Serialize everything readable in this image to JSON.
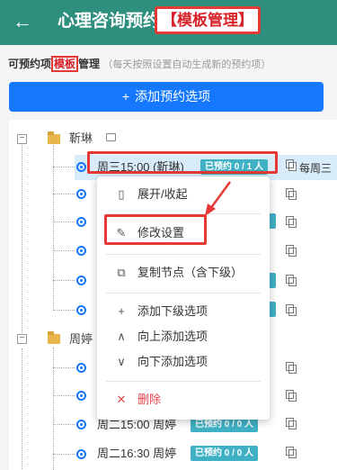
{
  "header": {
    "back_glyph": "←",
    "title": "心理咨询预约",
    "badge": "【模板管理】"
  },
  "subtitle": {
    "prefix": "可预约项",
    "highlight": "模板",
    "suffix": "管理",
    "note": "（每天按照设置自动生成新的预约项）"
  },
  "add_button": {
    "icon": "+",
    "label": "添加预约选项"
  },
  "tree": {
    "groups": [
      {
        "label": "靳琳",
        "expander": "−"
      },
      {
        "label": "周婷",
        "expander": "−"
      }
    ],
    "selected_item": {
      "label": "周三15:00 (靳琳)",
      "badge": "已预约 0 / 1 人",
      "extra": "每周三"
    },
    "bottom_items": [
      {
        "label": "周二15:00 周婷",
        "badge": "已预约 0 / 0 人"
      },
      {
        "label": "周二16:30 周婷",
        "badge": "已预约 0 / 0 人"
      }
    ]
  },
  "context_menu": {
    "items": [
      {
        "label": "展开/收起",
        "icon": "book-icon",
        "glyph": "▯"
      },
      {
        "label": "修改设置",
        "icon": "pencil-icon",
        "glyph": "✎"
      },
      {
        "label": "复制节点（含下级）",
        "icon": "copy-icon",
        "glyph": "⧉"
      },
      {
        "label": "添加下级选项",
        "icon": "plus-icon",
        "glyph": "+"
      },
      {
        "label": "向上添加选项",
        "icon": "chevron-up-icon",
        "glyph": "∧"
      },
      {
        "label": "向下添加选项",
        "icon": "chevron-down-icon",
        "glyph": "∨"
      },
      {
        "label": "删除",
        "icon": "close-icon",
        "glyph": "✕"
      }
    ]
  },
  "colors": {
    "header_bg": "#2e8f7e",
    "primary": "#1677ff",
    "badge": "#40b1c4",
    "highlight_border": "#e53935",
    "danger": "#e5454a"
  }
}
